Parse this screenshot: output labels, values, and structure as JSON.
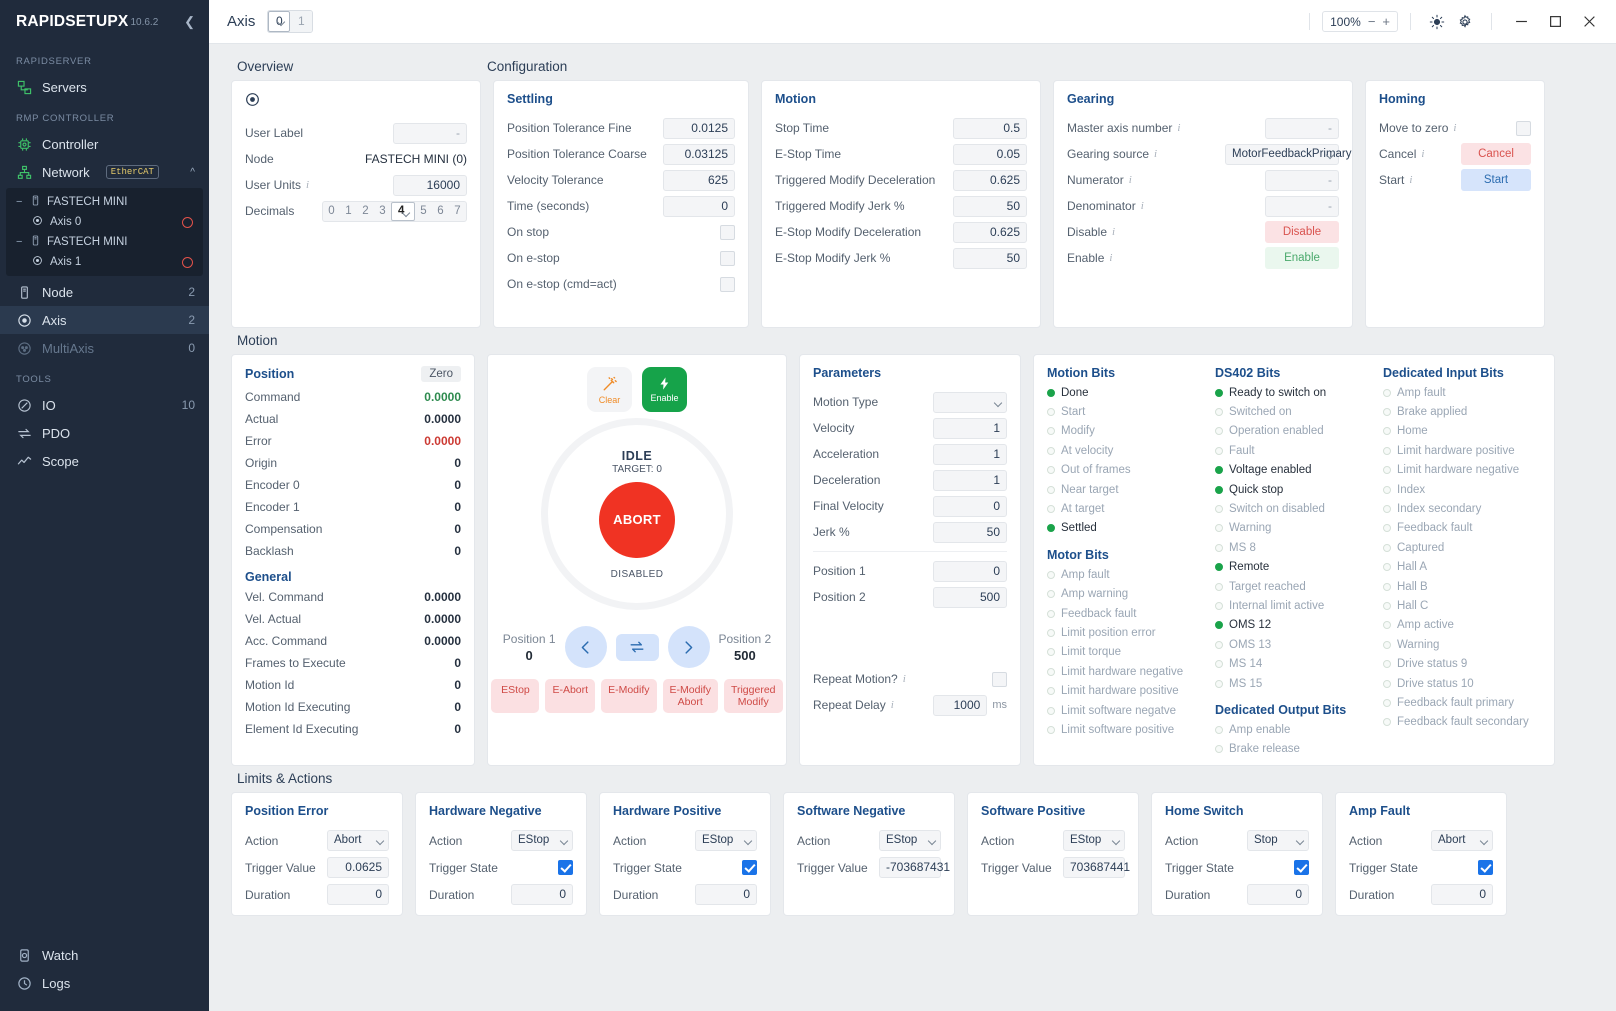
{
  "sidebar": {
    "brand": "RAPIDSETUPX",
    "version": "10.6.2",
    "groups": [
      {
        "label": "RAPIDSERVER",
        "items": [
          {
            "label": "Servers",
            "icon": "servers-icon",
            "count": ""
          }
        ]
      },
      {
        "label": "RMP CONTROLLER",
        "items": [
          {
            "label": "Controller",
            "icon": "controller-icon",
            "count": ""
          },
          {
            "label": "Network",
            "icon": "network-icon",
            "badge": "EtherCAT",
            "count": ""
          },
          {
            "label": "Node",
            "icon": "node-icon",
            "count": "2"
          },
          {
            "label": "Axis",
            "icon": "axis-icon",
            "count": "2",
            "active": true
          },
          {
            "label": "MultiAxis",
            "icon": "multiaxis-icon",
            "count": "0",
            "muted": true
          }
        ]
      },
      {
        "label": "TOOLS",
        "items": [
          {
            "label": "IO",
            "icon": "io-icon",
            "count": "10"
          },
          {
            "label": "PDO",
            "icon": "pdo-icon",
            "count": ""
          },
          {
            "label": "Scope",
            "icon": "scope-icon",
            "count": ""
          }
        ]
      }
    ],
    "tree": [
      {
        "type": "node",
        "label": "FASTECH MINI"
      },
      {
        "type": "leaf",
        "label": "Axis 0"
      },
      {
        "type": "node",
        "label": "FASTECH MINI"
      },
      {
        "type": "leaf",
        "label": "Axis 1"
      }
    ],
    "bottom": [
      {
        "label": "Watch",
        "icon": "watch-icon"
      },
      {
        "label": "Logs",
        "icon": "logs-icon"
      }
    ]
  },
  "topbar": {
    "title": "Axis",
    "axis_tabs": [
      "0",
      "1"
    ],
    "selected_axis": "0",
    "zoom": "100%",
    "zoom_minus": "−",
    "zoom_plus": "+"
  },
  "sections": {
    "overview": "Overview",
    "configuration": "Configuration",
    "motion": "Motion",
    "limits": "Limits & Actions"
  },
  "overview": {
    "rows": [
      {
        "label": "User Label",
        "value": "-",
        "type": "input-empty"
      },
      {
        "label": "Node",
        "value": "FASTECH MINI (0)",
        "type": "text"
      },
      {
        "label": "User Units",
        "value": "16000",
        "type": "input",
        "info": true
      },
      {
        "label": "Decimals",
        "value": "4",
        "type": "decimals"
      }
    ],
    "decimals": [
      "0",
      "1",
      "2",
      "3",
      "4",
      "5",
      "6",
      "7"
    ],
    "decimals_selected": "4"
  },
  "settling": {
    "title": "Settling",
    "rows": [
      {
        "label": "Position Tolerance Fine",
        "value": "0.0125",
        "type": "input"
      },
      {
        "label": "Position Tolerance Coarse",
        "value": "0.03125",
        "type": "input"
      },
      {
        "label": "Velocity Tolerance",
        "value": "625",
        "type": "input"
      },
      {
        "label": "Time (seconds)",
        "value": "0",
        "type": "input"
      },
      {
        "label": "On stop",
        "value": "",
        "type": "checkbox",
        "checked": false
      },
      {
        "label": "On e-stop",
        "value": "",
        "type": "checkbox",
        "checked": false
      },
      {
        "label": "On e-stop (cmd=act)",
        "value": "",
        "type": "checkbox",
        "checked": false
      }
    ]
  },
  "motion_cfg": {
    "title": "Motion",
    "rows": [
      {
        "label": "Stop Time",
        "value": "0.5",
        "type": "input"
      },
      {
        "label": "E-Stop Time",
        "value": "0.05",
        "type": "input"
      },
      {
        "label": "Triggered Modify Deceleration",
        "value": "0.625",
        "type": "input"
      },
      {
        "label": "Triggered Modify Jerk %",
        "value": "50",
        "type": "input"
      },
      {
        "label": "E-Stop Modify Deceleration",
        "value": "0.625",
        "type": "input"
      },
      {
        "label": "E-Stop Modify Jerk %",
        "value": "50",
        "type": "input"
      }
    ]
  },
  "gearing": {
    "title": "Gearing",
    "rows": [
      {
        "label": "Master axis number",
        "value": "-",
        "type": "input-empty",
        "info": true
      },
      {
        "label": "Gearing source",
        "value": "MotorFeedbackPrimary",
        "type": "select",
        "info": true
      },
      {
        "label": "Numerator",
        "value": "-",
        "type": "input-empty",
        "info": true
      },
      {
        "label": "Denominator",
        "value": "-",
        "type": "input-empty",
        "info": true
      },
      {
        "label": "Disable",
        "value": "Disable",
        "type": "btn-pink",
        "info": true
      },
      {
        "label": "Enable",
        "value": "Enable",
        "type": "btn-green",
        "info": true
      }
    ]
  },
  "homing": {
    "title": "Homing",
    "rows": [
      {
        "label": "Move to zero",
        "value": "",
        "type": "checkbox",
        "checked": false,
        "info": true
      },
      {
        "label": "Cancel",
        "value": "Cancel",
        "type": "btn-pink",
        "info": true
      },
      {
        "label": "Start",
        "value": "Start",
        "type": "btn-blue",
        "info": true
      }
    ]
  },
  "position_panel": {
    "title": "Position",
    "zero_label": "Zero",
    "rows": [
      {
        "label": "Command",
        "value": "0.0000",
        "color": "green"
      },
      {
        "label": "Actual",
        "value": "0.0000",
        "color": ""
      },
      {
        "label": "Error",
        "value": "0.0000",
        "color": "red"
      },
      {
        "label": "Origin",
        "value": "0",
        "color": ""
      },
      {
        "label": "Encoder 0",
        "value": "0",
        "color": ""
      },
      {
        "label": "Encoder 1",
        "value": "0",
        "color": ""
      },
      {
        "label": "Compensation",
        "value": "0",
        "color": ""
      },
      {
        "label": "Backlash",
        "value": "0",
        "color": ""
      }
    ],
    "general_title": "General",
    "general_rows": [
      {
        "label": "Vel. Command",
        "value": "0.0000"
      },
      {
        "label": "Vel. Actual",
        "value": "0.0000"
      },
      {
        "label": "Acc. Command",
        "value": "0.0000"
      },
      {
        "label": "Frames to Execute",
        "value": "0"
      },
      {
        "label": "Motion Id",
        "value": "0"
      },
      {
        "label": "Motion Id Executing",
        "value": "0"
      },
      {
        "label": "Element Id Executing",
        "value": "0"
      }
    ]
  },
  "control": {
    "clear_label": "Clear",
    "enable_label": "Enable",
    "state": "IDLE",
    "target": "TARGET: 0",
    "abort_label": "ABORT",
    "disabled_label": "DISABLED",
    "pos1_label": "Position 1",
    "pos1_value": "0",
    "pos2_label": "Position 2",
    "pos2_value": "500",
    "estop_buttons": [
      "EStop",
      "E-Abort",
      "E-Modify",
      "E-Modify Abort",
      "Triggered Modify"
    ]
  },
  "parameters": {
    "title": "Parameters",
    "rows": [
      {
        "label": "Motion Type",
        "value": "",
        "type": "select"
      },
      {
        "label": "Velocity",
        "value": "1",
        "type": "input"
      },
      {
        "label": "Acceleration",
        "value": "1",
        "type": "input"
      },
      {
        "label": "Deceleration",
        "value": "1",
        "type": "input"
      },
      {
        "label": "Final Velocity",
        "value": "0",
        "type": "input"
      },
      {
        "label": "Jerk %",
        "value": "50",
        "type": "input"
      }
    ],
    "rows2": [
      {
        "label": "Position 1",
        "value": "0",
        "type": "input"
      },
      {
        "label": "Position 2",
        "value": "500",
        "type": "input"
      }
    ],
    "repeat_motion_label": "Repeat Motion?",
    "repeat_motion_checked": false,
    "repeat_delay_label": "Repeat Delay",
    "repeat_delay_value": "1000",
    "repeat_delay_unit": "ms"
  },
  "bits": {
    "motion": {
      "title": "Motion Bits",
      "items": [
        {
          "label": "Done",
          "on": true
        },
        {
          "label": "Start",
          "on": false
        },
        {
          "label": "Modify",
          "on": false
        },
        {
          "label": "At velocity",
          "on": false
        },
        {
          "label": "Out of frames",
          "on": false
        },
        {
          "label": "Near target",
          "on": false
        },
        {
          "label": "At target",
          "on": false
        },
        {
          "label": "Settled",
          "on": true
        }
      ]
    },
    "motor": {
      "title": "Motor Bits",
      "items": [
        {
          "label": "Amp fault",
          "on": false
        },
        {
          "label": "Amp warning",
          "on": false
        },
        {
          "label": "Feedback fault",
          "on": false
        },
        {
          "label": "Limit position error",
          "on": false
        },
        {
          "label": "Limit torque",
          "on": false
        },
        {
          "label": "Limit hardware negative",
          "on": false
        },
        {
          "label": "Limit hardware positive",
          "on": false
        },
        {
          "label": "Limit software negatve",
          "on": false
        },
        {
          "label": "Limit software positive",
          "on": false
        }
      ]
    },
    "ds402": {
      "title": "DS402 Bits",
      "items": [
        {
          "label": "Ready to switch on",
          "on": true
        },
        {
          "label": "Switched on",
          "on": false
        },
        {
          "label": "Operation enabled",
          "on": false
        },
        {
          "label": "Fault",
          "on": false
        },
        {
          "label": "Voltage enabled",
          "on": true
        },
        {
          "label": "Quick stop",
          "on": true
        },
        {
          "label": "Switch on disabled",
          "on": false
        },
        {
          "label": "Warning",
          "on": false
        },
        {
          "label": "MS 8",
          "on": false
        },
        {
          "label": "Remote",
          "on": true
        },
        {
          "label": "Target reached",
          "on": false
        },
        {
          "label": "Internal limit active",
          "on": false
        },
        {
          "label": "OMS 12",
          "on": true
        },
        {
          "label": "OMS 13",
          "on": false
        },
        {
          "label": "MS 14",
          "on": false
        },
        {
          "label": "MS 15",
          "on": false
        }
      ]
    },
    "dedicated_output": {
      "title": "Dedicated Output Bits",
      "items": [
        {
          "label": "Amp enable",
          "on": false
        },
        {
          "label": "Brake release",
          "on": false
        }
      ]
    },
    "dedicated_input": {
      "title": "Dedicated Input Bits",
      "items": [
        {
          "label": "Amp fault",
          "on": false
        },
        {
          "label": "Brake applied",
          "on": false
        },
        {
          "label": "Home",
          "on": false
        },
        {
          "label": "Limit hardware positive",
          "on": false
        },
        {
          "label": "Limit hardware negative",
          "on": false
        },
        {
          "label": "Index",
          "on": false
        },
        {
          "label": "Index secondary",
          "on": false
        },
        {
          "label": "Feedback fault",
          "on": false
        },
        {
          "label": "Captured",
          "on": false
        },
        {
          "label": "Hall A",
          "on": false
        },
        {
          "label": "Hall B",
          "on": false
        },
        {
          "label": "Hall C",
          "on": false
        },
        {
          "label": "Amp active",
          "on": false
        },
        {
          "label": "Warning",
          "on": false
        },
        {
          "label": "Drive status 9",
          "on": false
        },
        {
          "label": "Drive status 10",
          "on": false
        },
        {
          "label": "Feedback fault primary",
          "on": false
        },
        {
          "label": "Feedback fault secondary",
          "on": false
        }
      ]
    }
  },
  "limits": [
    {
      "title": "Position Error",
      "rows": [
        {
          "label": "Action",
          "value": "Abort",
          "type": "select"
        },
        {
          "label": "Trigger Value",
          "value": "0.0625",
          "type": "input"
        },
        {
          "label": "Duration",
          "value": "0",
          "type": "input"
        }
      ]
    },
    {
      "title": "Hardware Negative",
      "rows": [
        {
          "label": "Action",
          "value": "EStop",
          "type": "select"
        },
        {
          "label": "Trigger State",
          "value": "",
          "type": "checkbox",
          "checked": true
        },
        {
          "label": "Duration",
          "value": "0",
          "type": "input"
        }
      ]
    },
    {
      "title": "Hardware Positive",
      "rows": [
        {
          "label": "Action",
          "value": "EStop",
          "type": "select"
        },
        {
          "label": "Trigger State",
          "value": "",
          "type": "checkbox",
          "checked": true
        },
        {
          "label": "Duration",
          "value": "0",
          "type": "input"
        }
      ]
    },
    {
      "title": "Software Negative",
      "rows": [
        {
          "label": "Action",
          "value": "EStop",
          "type": "select"
        },
        {
          "label": "Trigger Value",
          "value": "-703687431",
          "type": "input"
        }
      ]
    },
    {
      "title": "Software Positive",
      "rows": [
        {
          "label": "Action",
          "value": "EStop",
          "type": "select"
        },
        {
          "label": "Trigger Value",
          "value": "703687441",
          "type": "input"
        }
      ]
    },
    {
      "title": "Home Switch",
      "rows": [
        {
          "label": "Action",
          "value": "Stop",
          "type": "select"
        },
        {
          "label": "Trigger State",
          "value": "",
          "type": "checkbox",
          "checked": true
        },
        {
          "label": "Duration",
          "value": "0",
          "type": "input"
        }
      ]
    },
    {
      "title": "Amp Fault",
      "rows": [
        {
          "label": "Action",
          "value": "Abort",
          "type": "select"
        },
        {
          "label": "Trigger State",
          "value": "",
          "type": "checkbox",
          "checked": true
        },
        {
          "label": "Duration",
          "value": "0",
          "type": "input"
        }
      ]
    }
  ]
}
